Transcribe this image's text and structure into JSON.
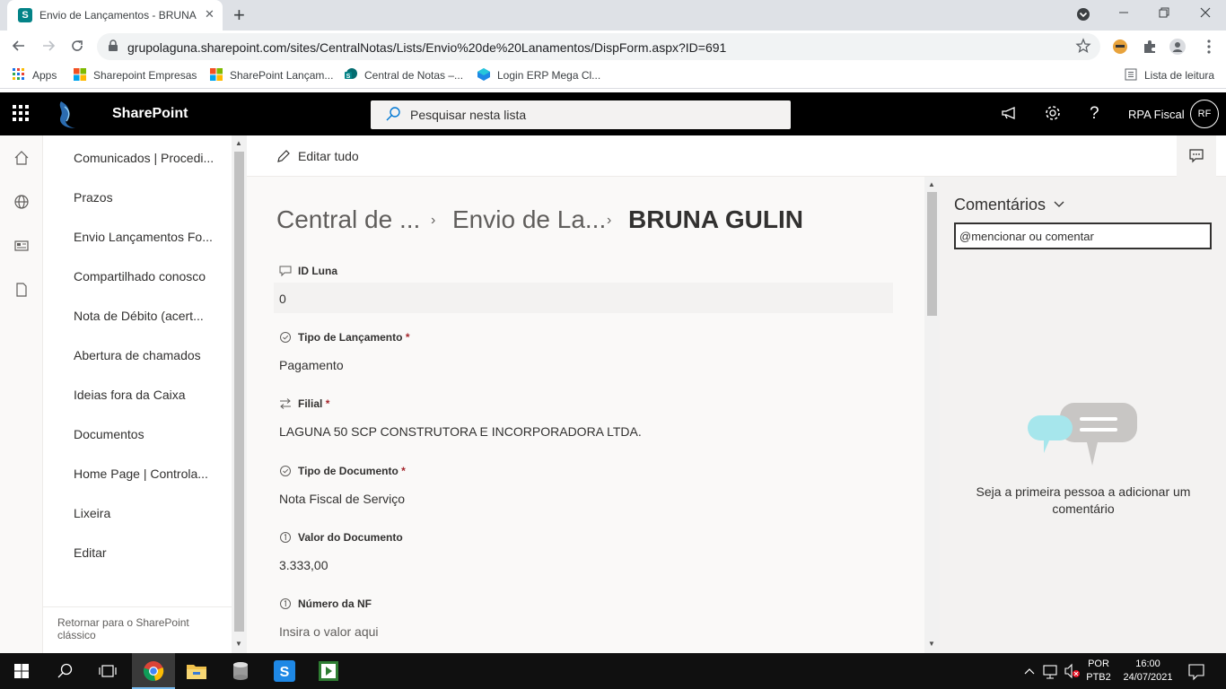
{
  "browser": {
    "tab_title": "Envio de Lançamentos - BRUNA GULIN",
    "tab_close": "✕",
    "new_tab": "+",
    "url": "grupolaguna.sharepoint.com/sites/CentralNotas/Lists/Envio%20de%20Lanamentos/DispForm.aspx?ID=691",
    "bookmarks": [
      {
        "label": "Apps",
        "icon": "apps-grid-icon"
      },
      {
        "label": "Sharepoint Empresas",
        "icon": "microsoft-icon"
      },
      {
        "label": "SharePoint Lançam...",
        "icon": "microsoft-icon"
      },
      {
        "label": "Central de Notas –...",
        "icon": "sharepoint-icon"
      },
      {
        "label": "Login ERP Mega Cl...",
        "icon": "mega-icon"
      }
    ],
    "reading_list": "Lista de leitura"
  },
  "suitebar": {
    "app_name": "SharePoint",
    "search_placeholder": "Pesquisar nesta lista",
    "user_name": "RPA Fiscal",
    "user_initials": "RF"
  },
  "leftnav": {
    "items": [
      "Comunicados | Procedi...",
      "Prazos",
      "Envio Lançamentos Fo...",
      "Compartilhado conosco",
      "Nota de Débito (acert...",
      "Abertura de chamados",
      "Ideias fora da Caixa",
      "Documentos",
      "Home Page | Controla...",
      "Lixeira",
      "Editar"
    ],
    "classic_link": "Retornar para o SharePoint clássico"
  },
  "commandbar": {
    "edit_all": "Editar tudo"
  },
  "breadcrumb": {
    "items": [
      "Central de ...",
      "Envio de La..."
    ],
    "current": "BRUNA GULIN",
    "separator": "›"
  },
  "fields": [
    {
      "label": "ID Luna",
      "required": "",
      "value": "0",
      "icon": "comment-icon"
    },
    {
      "label": "Tipo de Lançamento",
      "required": "*",
      "value": "Pagamento",
      "icon": "choice-icon"
    },
    {
      "label": "Filial",
      "required": "*",
      "value": "LAGUNA 50 SCP CONSTRUTORA E INCORPORADORA LTDA.",
      "icon": "lookup-icon"
    },
    {
      "label": "Tipo de Documento",
      "required": "*",
      "value": "Nota Fiscal de Serviço",
      "icon": "choice-icon"
    },
    {
      "label": "Valor do Documento",
      "required": "",
      "value": "3.333,00",
      "icon": "number-icon"
    },
    {
      "label": "Número da NF",
      "required": "",
      "value": "Insira o valor aqui",
      "icon": "number-icon"
    }
  ],
  "comments": {
    "title": "Comentários",
    "input_placeholder": "@mencionar ou comentar",
    "empty_message": "Seja a primeira pessoa a adicionar um comentário"
  },
  "taskbar": {
    "lang_line1": "POR",
    "lang_line2": "PTB2",
    "time": "16:00",
    "date": "24/07/2021"
  }
}
